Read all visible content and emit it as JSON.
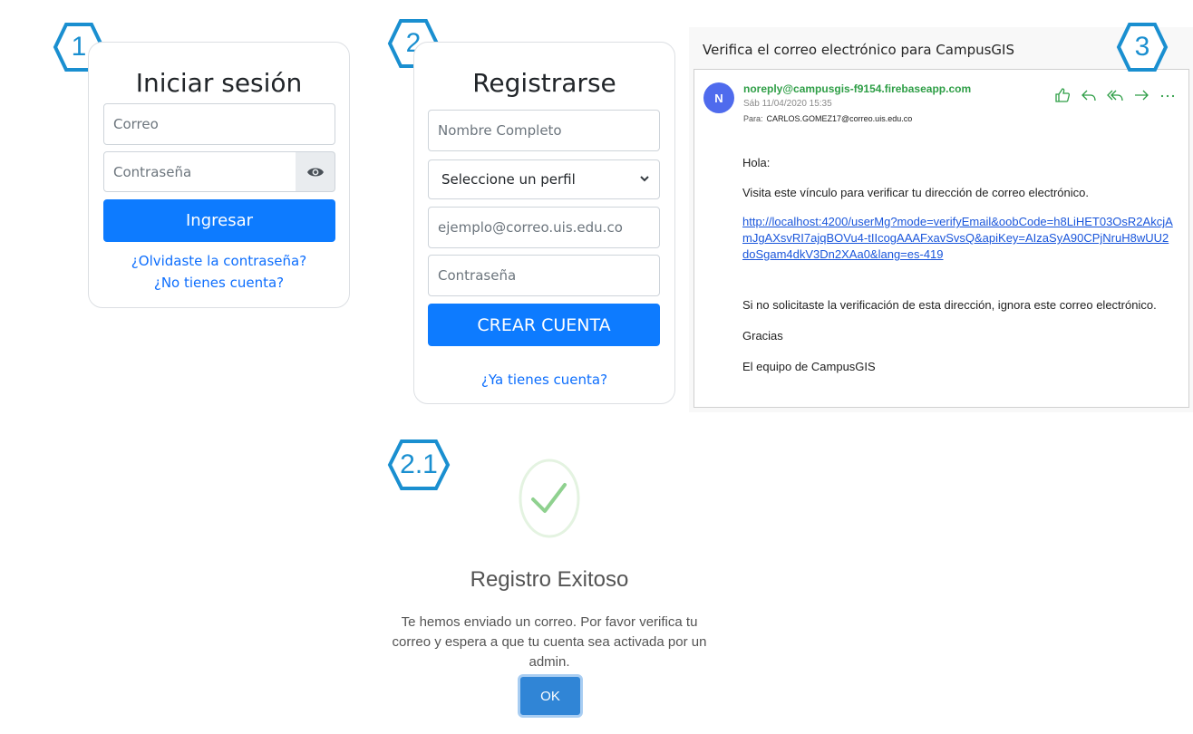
{
  "badges": {
    "step1": "1",
    "step2": "2",
    "step2_1": "2.1",
    "step3": "3"
  },
  "login": {
    "title": "Iniciar sesión",
    "email_placeholder": "Correo",
    "password_placeholder": "Contraseña",
    "submit_label": "Ingresar",
    "forgot_link": "¿Olvidaste la contraseña?",
    "register_link": "¿No tienes cuenta?"
  },
  "register": {
    "title": "Registrarse",
    "name_placeholder": "Nombre Completo",
    "profile_select": "Seleccione un perfil",
    "email_placeholder": "ejemplo@correo.uis.edu.co",
    "password_placeholder": "Contraseña",
    "submit_label": "CREAR CUENTA",
    "login_link": "¿Ya tienes cuenta?"
  },
  "email": {
    "subject": "Verifica el correo electrónico para CampusGIS",
    "avatar_letter": "N",
    "sender": "noreply@campusgis-f9154.firebaseapp.com",
    "date": "Sáb 11/04/2020 15:35",
    "to_label": "Para:",
    "to": "CARLOS.GOMEZ17@correo.uis.edu.co",
    "greeting": "Hola:",
    "line1": "Visita este vínculo para verificar tu dirección de correo electrónico.",
    "link": "http://localhost:4200/userMg?mode=verifyEmail&oobCode=h8LiHET03OsR2AkcjAmJgAXsvRI7ajqBOVu4-tIIcogAAAFxavSvsQ&apiKey=AIzaSyA90CPjNruH8wUU2doSgam4dkV3Dn2XAa0&lang=es-419",
    "line2": "Si no solicitaste la verificación de esta dirección, ignora este correo electrónico.",
    "thanks": "Gracias",
    "signature": "El equipo de CampusGIS",
    "action_icons": [
      "thumbs-up-icon",
      "reply-icon",
      "reply-all-icon",
      "forward-icon",
      "more-icon"
    ]
  },
  "success": {
    "title": "Registro Exitoso",
    "message": "Te hemos enviado un correo. Por favor verifica tu correo y espera a que tu cuenta sea activada por un admin.",
    "ok_label": "OK"
  },
  "colors": {
    "primary": "#0d7bff",
    "link": "#0d6efd",
    "badge": "#1a8fd0",
    "success_check": "#8fd18f",
    "sender": "#2e9e46",
    "avatar": "#4f6bed",
    "ok_button": "#3085d6"
  }
}
